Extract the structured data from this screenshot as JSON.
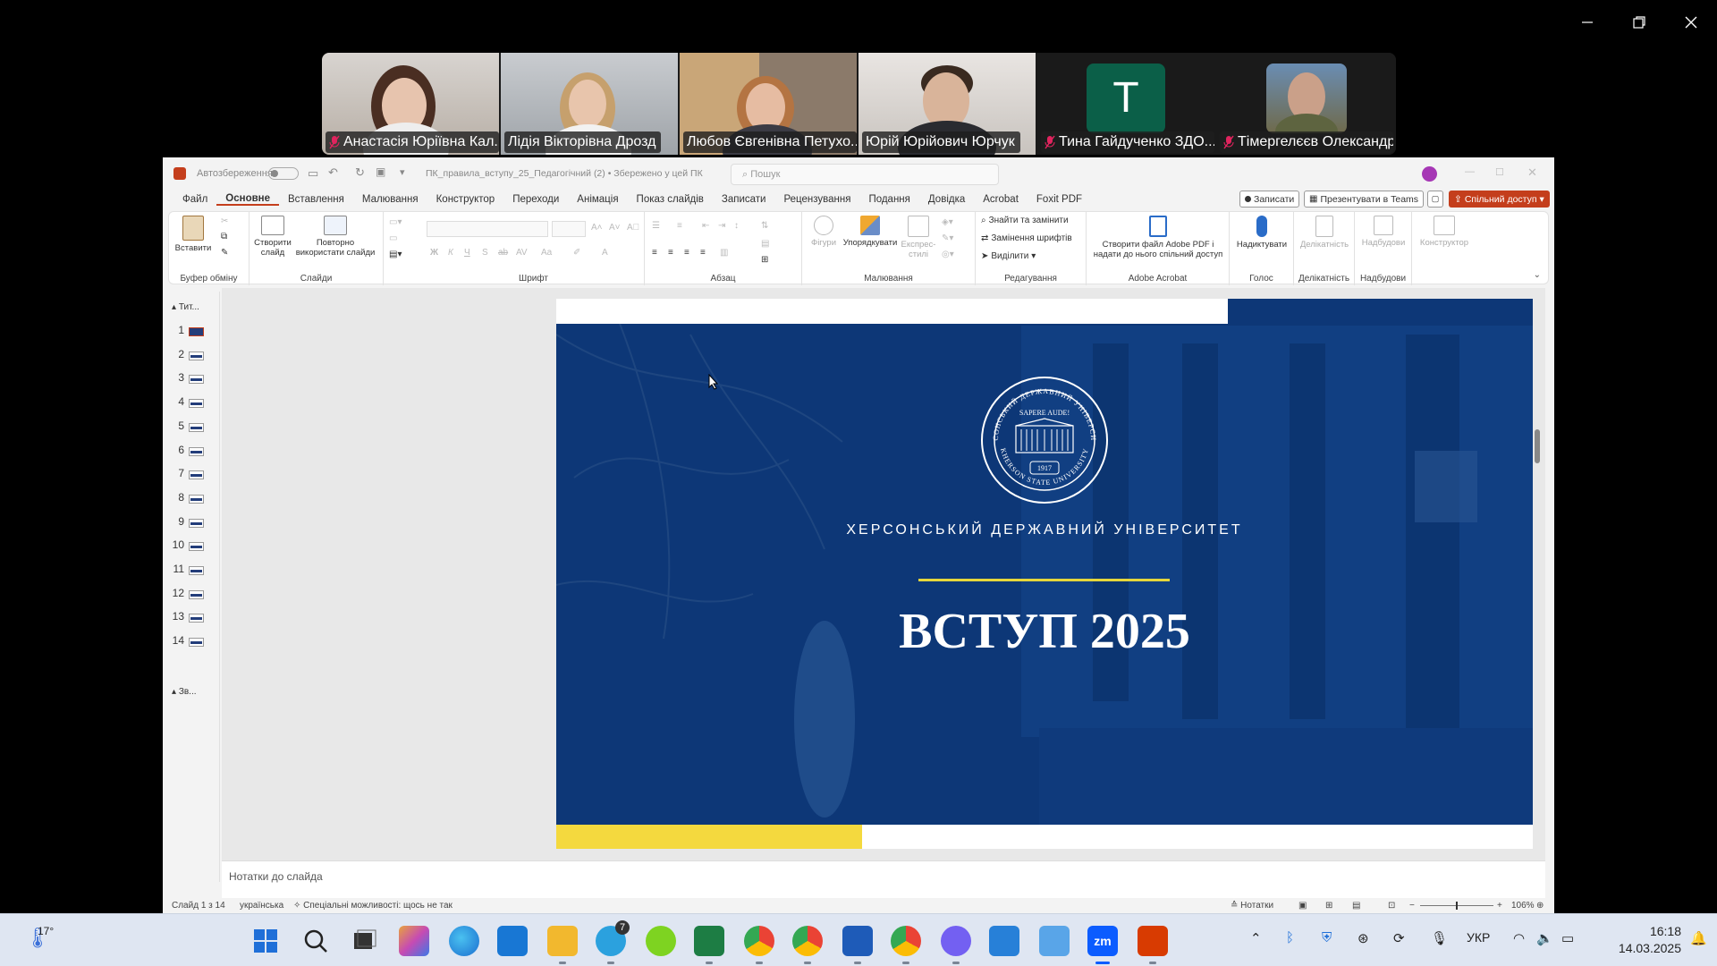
{
  "zoom": {
    "participants": [
      {
        "name": "Анастасія Юріївна Кал...",
        "muted": true
      },
      {
        "name": "Лідія Вікторівна Дрозд",
        "muted": false
      },
      {
        "name": "Любов Євгенівна Петухо...",
        "muted": false
      },
      {
        "name": "Юрій Юрійович Юрчук",
        "muted": false,
        "active": true
      },
      {
        "name": "Тина Гайдученко ЗДО...",
        "muted": true,
        "initial": "T"
      },
      {
        "name": "Тімергелєєв Олександр",
        "muted": true
      }
    ]
  },
  "ppt": {
    "autosave_label": "Автозбереження",
    "filename": "ПК_правила_вступу_25_Педагогічний (2)  •  Збережено у цей ПК",
    "search_placeholder": "Пошук",
    "menu": [
      "Файл",
      "Основне",
      "Вставлення",
      "Малювання",
      "Конструктор",
      "Переходи",
      "Анімація",
      "Показ слайдів",
      "Записати",
      "Рецензування",
      "Подання",
      "Довідка",
      "Acrobat",
      "Foxit PDF"
    ],
    "right_buttons": {
      "record": "Записати",
      "present_teams": "Презентувати в Teams",
      "share": "Спільний доступ"
    },
    "ribbon": {
      "paste": "Вставити",
      "clipboard_group": "Буфер обміну",
      "new_slide": "Створити слайд",
      "reuse_slides": "Повторно використати слайди",
      "slides_group": "Слайди",
      "font_group": "Шрифт",
      "paragraph_group": "Абзац",
      "shapes": "Фігури",
      "arrange": "Упорядкувати",
      "express_styles": "Експрес-стилі",
      "drawing_group": "Малювання",
      "find_replace": "Знайти та замінити",
      "replace_fonts": "Замінення шрифтів",
      "select": "Виділити",
      "editing_group": "Редагування",
      "acrobat_create": "Створити файл Adobe PDF і надати до нього спільний доступ",
      "acrobat_group": "Adobe Acrobat",
      "dictate": "Надиктувати",
      "voice_group": "Голос",
      "sensitivity": "Делікатність",
      "sensitivity_group": "Делікатність",
      "addins": "Надбудови",
      "addins_group": "Надбудови",
      "designer": "Конструктор"
    },
    "outline": {
      "section1": "Тит...",
      "section2": "Зв..."
    },
    "slide_numbers": [
      "1",
      "2",
      "3",
      "4",
      "5",
      "6",
      "7",
      "8",
      "9",
      "10",
      "11",
      "12",
      "13",
      "14"
    ],
    "slide": {
      "seal_motto": "SAPERE AUDE!",
      "seal_top": "ХЕРСОНСЬКИЙ ДЕРЖАВНИЙ УНІВЕРСИТЕТ",
      "seal_bottom": "KHERSON STATE UNIVERSITY",
      "seal_year": "1917",
      "university": "ХЕРСОНСЬКИЙ ДЕРЖАВНИЙ УНІВЕРСИТЕТ",
      "heading": "ВСТУП 2025"
    },
    "notes_placeholder": "Нотатки до слайда",
    "status": {
      "slide_info": "Слайд 1 з 14",
      "language": "українська",
      "accessibility": "Спеціальні можливості: щось не так",
      "notes_btn": "Нотатки",
      "zoom": "106%"
    }
  },
  "taskbar": {
    "temperature": "17°",
    "telegram_badge": "7",
    "language": "УКР",
    "time": "16:18",
    "date": "14.03.2025"
  }
}
